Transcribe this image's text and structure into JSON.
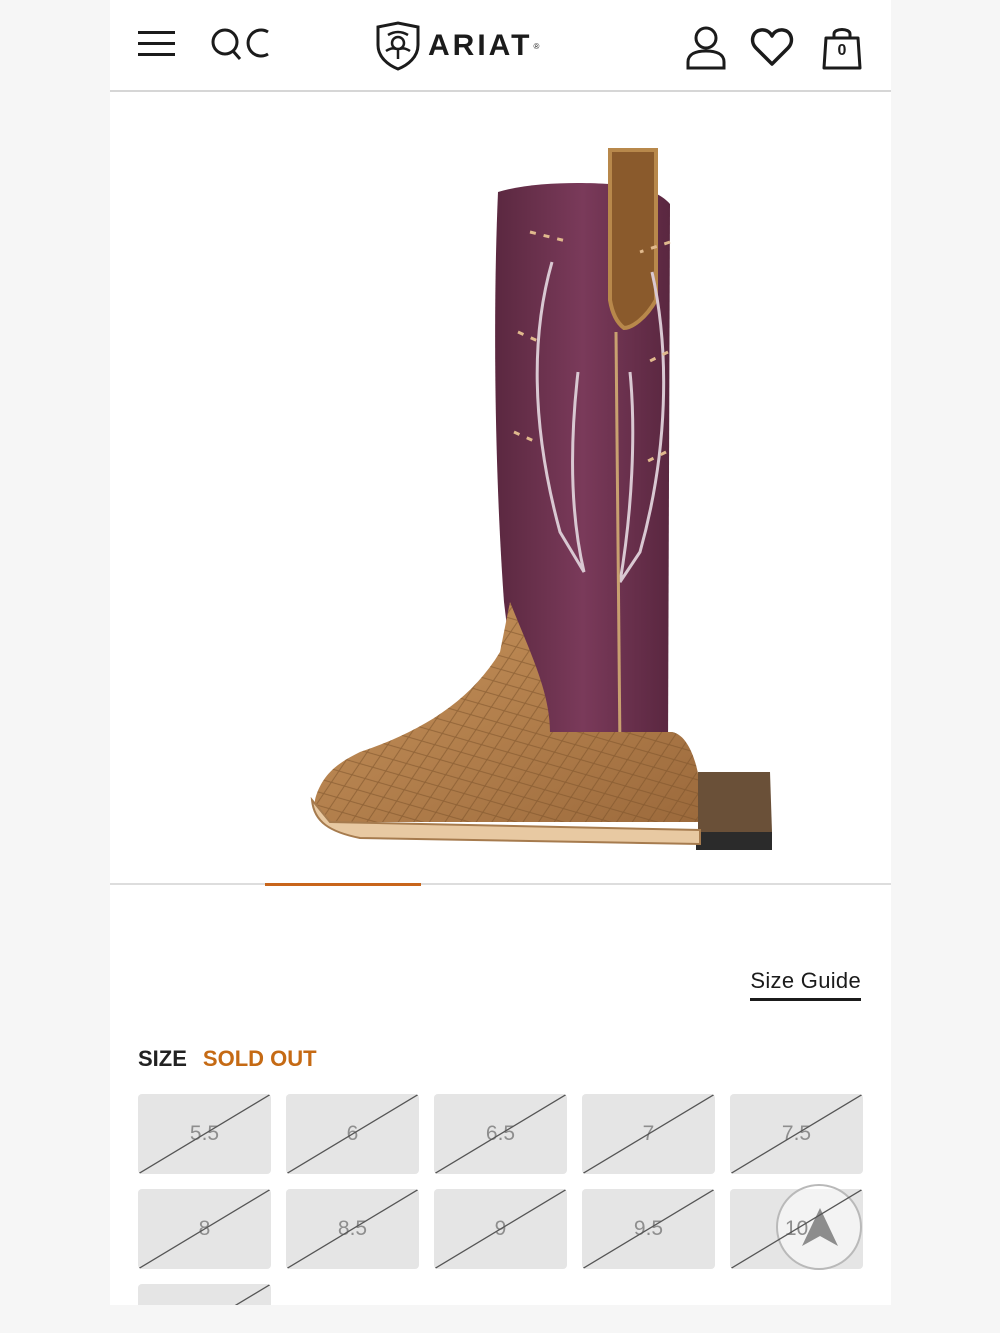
{
  "header": {
    "brand": "ARIAT",
    "brand_reg": "®",
    "bag_count": "0",
    "icons": [
      "menu-icon",
      "search-icon",
      "account-icon",
      "heart-icon",
      "bag-icon"
    ]
  },
  "gallery": {
    "active_slide_fraction": 0.2,
    "image_alt": "cowboy-boot"
  },
  "size_section": {
    "guide_label": "Size Guide",
    "label": "SIZE",
    "status": "SOLD OUT",
    "sizes": [
      "5.5",
      "6",
      "6.5",
      "7",
      "7.5",
      "8",
      "8.5",
      "9",
      "9.5",
      "10",
      ""
    ],
    "all_unavailable": true
  },
  "colors": {
    "accent": "#c8651b",
    "status": "#c56a14",
    "swatch_bg": "#e5e5e5",
    "boot_shaft": "#6e3350",
    "boot_vamp": "#b98550"
  }
}
